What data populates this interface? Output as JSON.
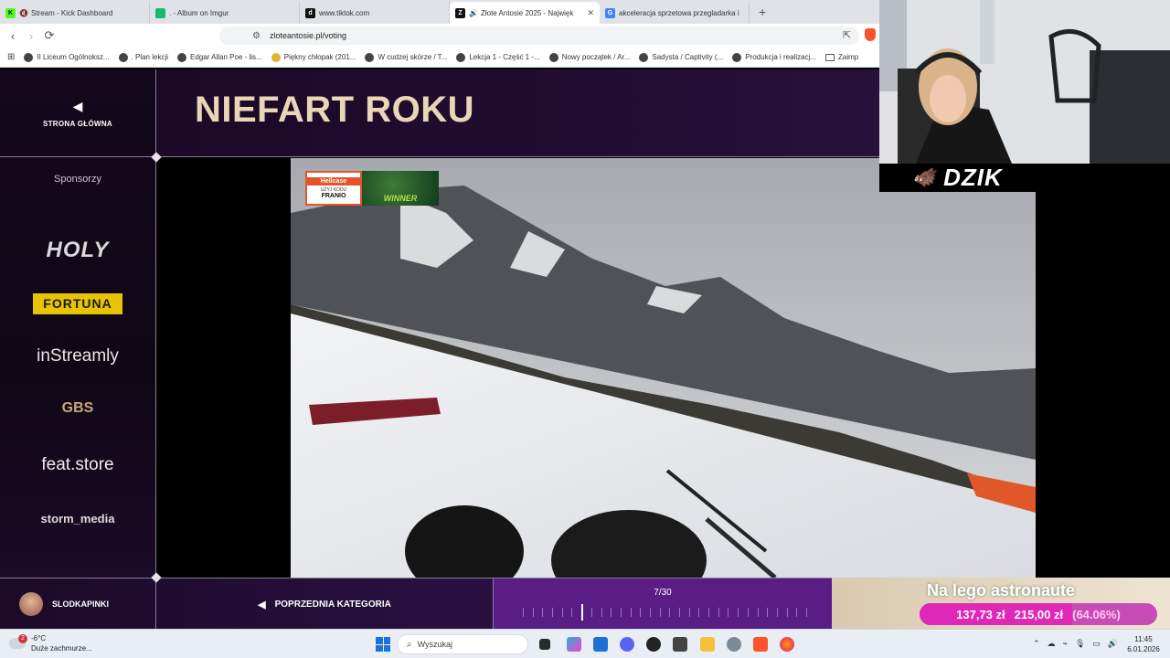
{
  "browser": {
    "tabs": [
      {
        "label": "Stream - Kick Dashboard",
        "favicon_color": "#53fc18",
        "favicon_letter": "K",
        "muted": true,
        "active": false
      },
      {
        "label": ". - Album on Imgur",
        "favicon_color": "#1bb76e",
        "favicon_letter": "",
        "muted": false,
        "active": false
      },
      {
        "label": "www.tiktok.com",
        "favicon_color": "#111111",
        "favicon_letter": "d",
        "muted": false,
        "active": false
      },
      {
        "label": "Złote Antosie 2025 - Najwięk",
        "favicon_color": "#111111",
        "favicon_letter": "Z",
        "muted": false,
        "active": true
      },
      {
        "label": "akceleracja sprzetowa przegladarka i",
        "favicon_color": "#4285f4",
        "favicon_letter": "G",
        "muted": false,
        "active": false
      }
    ],
    "new_tab": "+",
    "url": "zloteantosie.pl/voting",
    "bookmarks": [
      {
        "label": "II Liceum Ogólnoksz...",
        "icon": "seal"
      },
      {
        "label": ". Plan lekcji",
        "icon": "globe"
      },
      {
        "label": "Edgar Allan Poe - lis...",
        "icon": "globe"
      },
      {
        "label": "Piękny chłopak (201...",
        "icon": "face",
        "yellow": true
      },
      {
        "label": "W cudzej skórze / T...",
        "icon": "globe"
      },
      {
        "label": "Lekcja 1 - Część 1 -...",
        "icon": "globe"
      },
      {
        "label": "Nowy początek / Ar...",
        "icon": "globe"
      },
      {
        "label": "Sadysta / Captivity (...",
        "icon": "globe"
      },
      {
        "label": "Produkcja i realizacj...",
        "icon": "globe"
      },
      {
        "label": "Zaimp",
        "icon": "folder"
      }
    ]
  },
  "page": {
    "home_label": "STRONA GŁÓWNA",
    "category_title": "NIEFART ROKU",
    "sponsors_heading": "Sponsorzy",
    "sponsors": {
      "holy": "HOLY",
      "fortuna": "FORTUNA",
      "instreamly": "inStreamly",
      "gbs": "GBS",
      "feat": "feat.store",
      "storm": "storm_media"
    },
    "video_badge": {
      "brand": "Hellcase",
      "code_label": "UŻYJ KODU",
      "code": "FRANIO",
      "winner": "WINNER"
    },
    "user_name": "SLODKAPINKI",
    "prev_category": "POPRZEDNIA KATEGORIA",
    "progress": {
      "current": 7,
      "total": 30,
      "label": "7/30"
    }
  },
  "overlay": {
    "goal_title": "Na lego astronaute",
    "goal_current": "137,73 zł",
    "goal_target": "215,00 zł",
    "goal_percent": "(64.06%)",
    "goal_fraction": 0.6406,
    "sponsor_banner": "DZIK"
  },
  "taskbar": {
    "weather_temp": "-6°C",
    "weather_desc": "Duże zachmurze...",
    "notifications": "2",
    "search_placeholder": "Wyszukaj",
    "time": "11:45",
    "date": "6.01.2026"
  },
  "colors": {
    "accent_gold": "#e8d6b5",
    "progress_purple": "#5a1d86",
    "goal_pink": "#e028b8"
  }
}
